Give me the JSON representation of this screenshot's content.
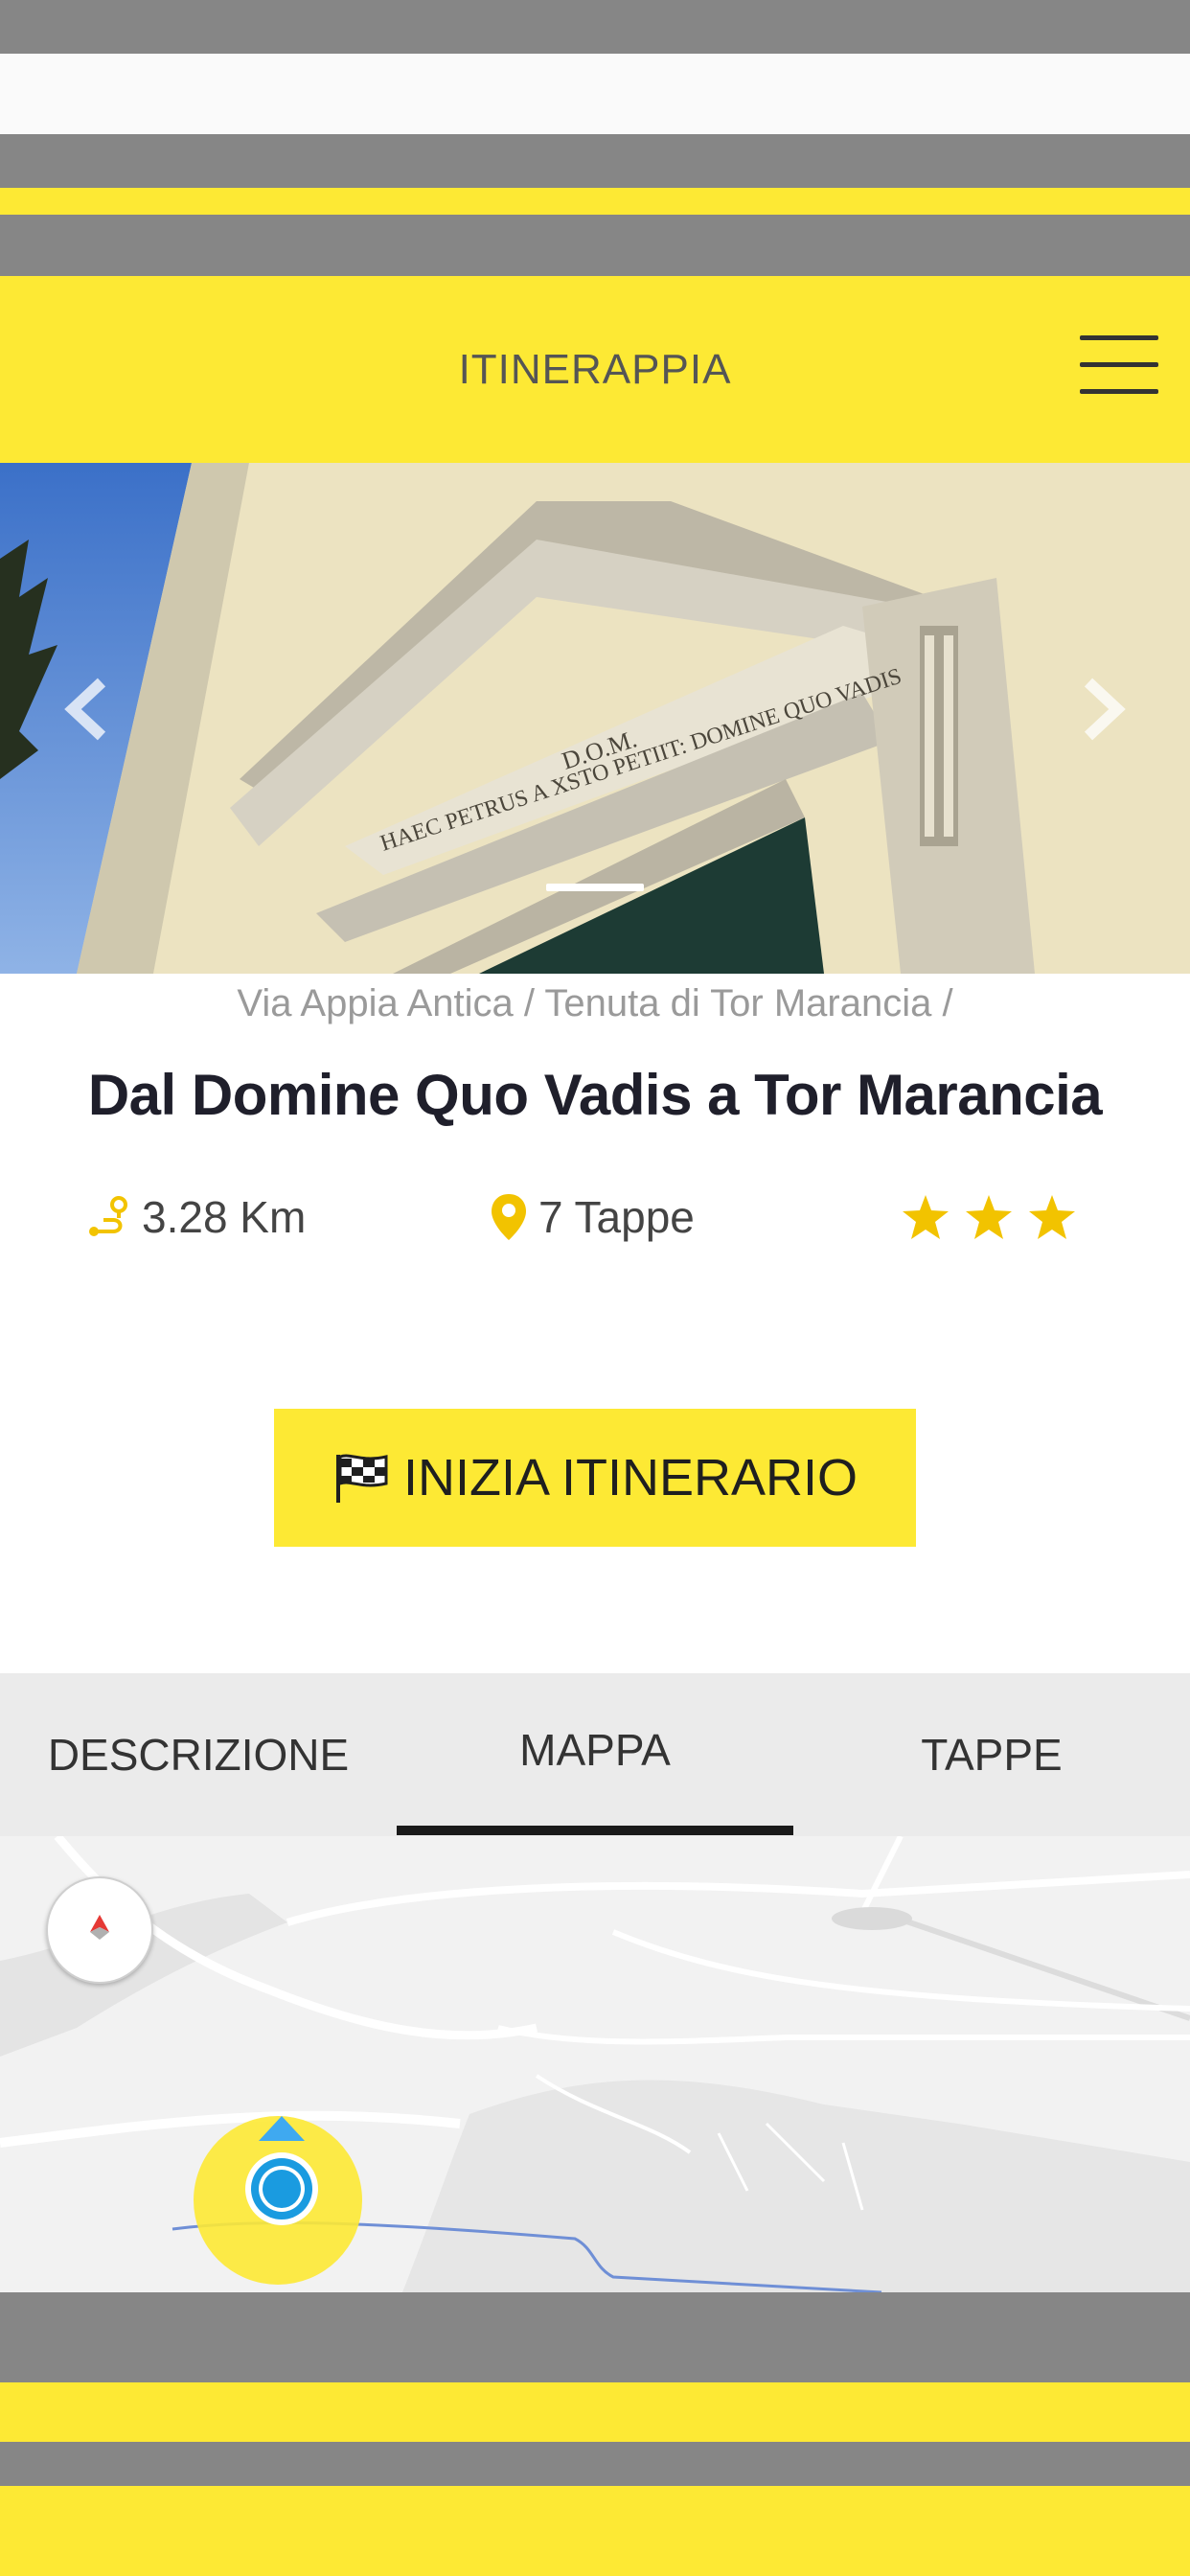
{
  "header": {
    "title": "ITINERAPPIA",
    "menu_icon": "hamburger-icon"
  },
  "carousel": {
    "slide_count": 1,
    "active_slide": 1,
    "prev_icon": "chevron-left-icon",
    "next_icon": "chevron-right-icon"
  },
  "route": {
    "breadcrumb": "Via Appia Antica / Tenuta di Tor Marancia /",
    "title": "Dal Domine Quo Vadis a Tor Marancia",
    "distance": "3.28 Km",
    "stops": "7 Tappe",
    "rating": 3
  },
  "actions": {
    "start_label": "INIZIA ITINERARIO",
    "start_icon": "checkered-flag-icon"
  },
  "tabs": [
    {
      "label": "DESCRIZIONE",
      "active": false
    },
    {
      "label": "MAPPA",
      "active": true
    },
    {
      "label": "TAPPE",
      "active": false
    }
  ],
  "map": {
    "compass_icon": "compass-icon",
    "location_icon": "location-marker-icon"
  },
  "colors": {
    "accent": "#fde934",
    "text_dark": "#1f1f2b",
    "muted": "#9a9a9a",
    "location_blue": "#1a9be0"
  }
}
